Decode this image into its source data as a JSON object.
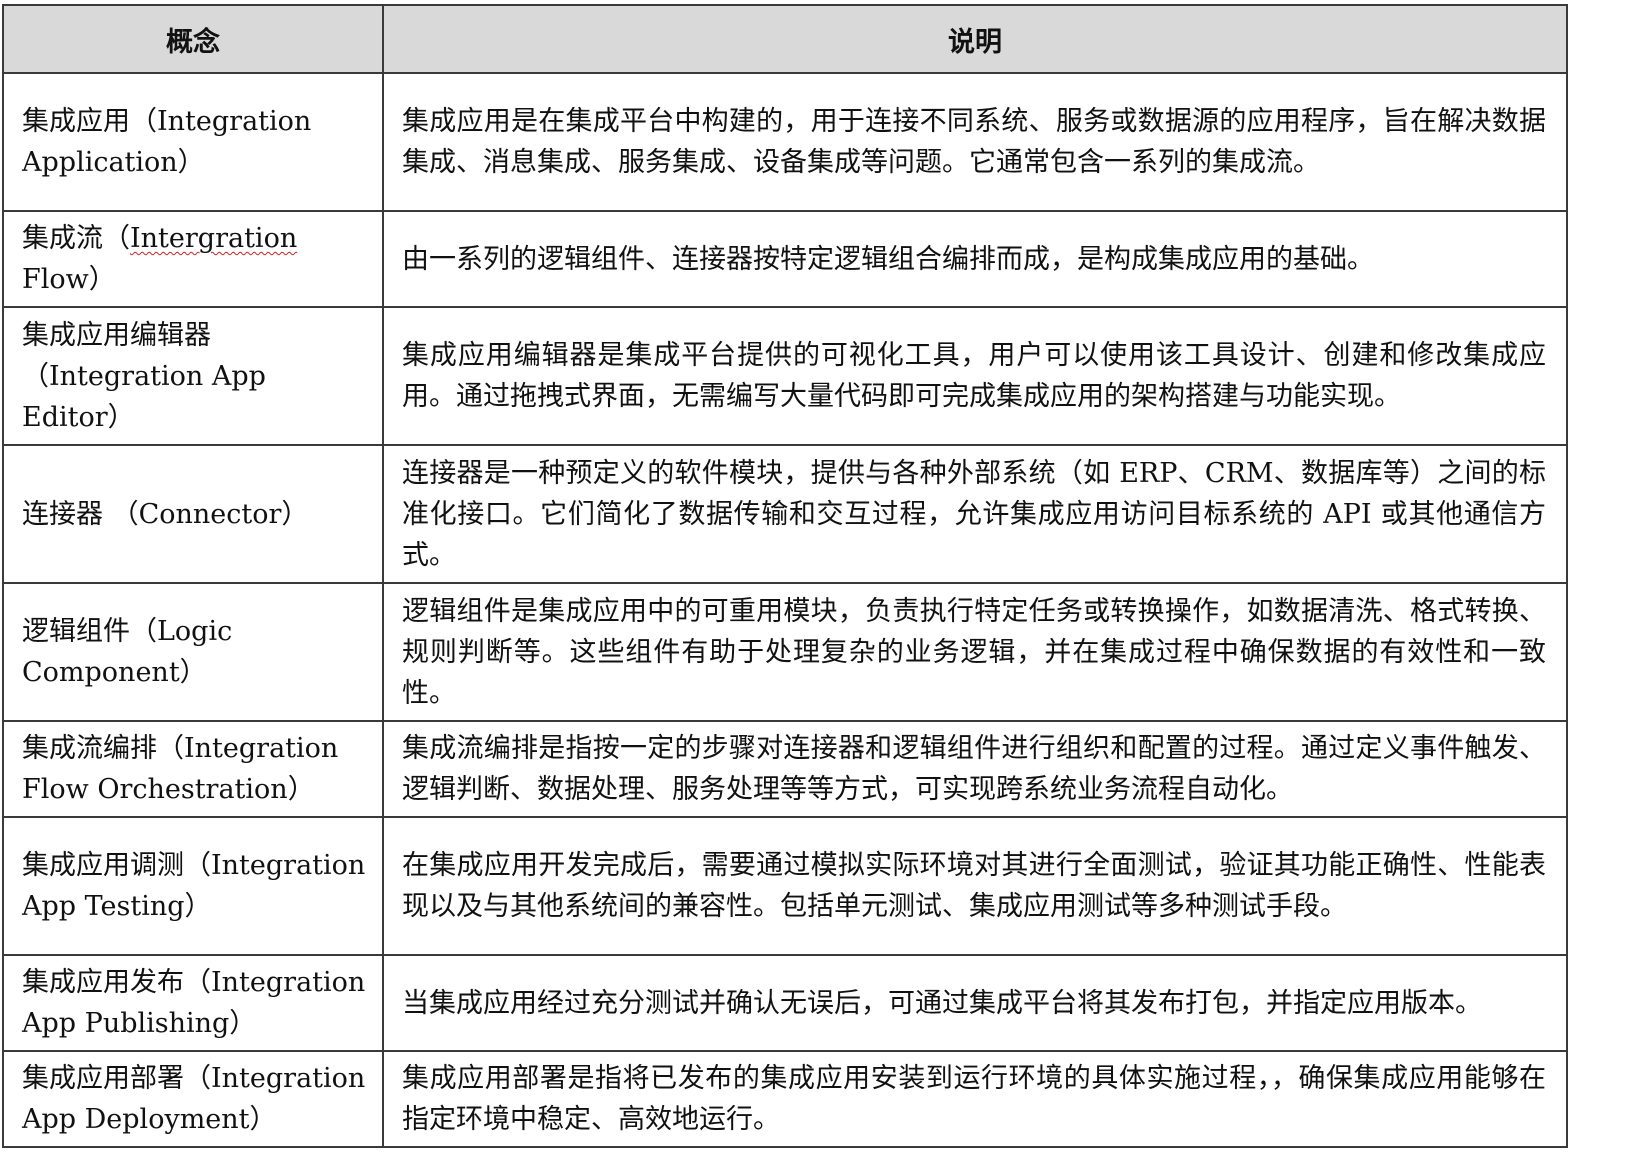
{
  "table": {
    "headers": {
      "concept": "概念",
      "description": "说明"
    },
    "rows": [
      {
        "term": "集成应用（Integration Application）",
        "description": "集成应用是在集成平台中构建的，用于连接不同系统、服务或数据源的应用程序，旨在解决数据集成、消息集成、服务集成、设备集成等问题。它通常包含一系列的集成流。"
      },
      {
        "term_prefix": "集成流（",
        "term_flagged": "Intergration",
        "term_suffix": " Flow）",
        "description": "由一系列的逻辑组件、连接器按特定逻辑组合编排而成，是构成集成应用的基础。"
      },
      {
        "term": "集成应用编辑器（Integration App Editor）",
        "description": "集成应用编辑器是集成平台提供的可视化工具，用户可以使用该工具设计、创建和修改集成应用。通过拖拽式界面，无需编写大量代码即可完成集成应用的架构搭建与功能实现。"
      },
      {
        "term": "连接器 （Connector）",
        "description": "连接器是一种预定义的软件模块，提供与各种外部系统（如 ERP、CRM、数据库等）之间的标准化接口。它们简化了数据传输和交互过程，允许集成应用访问目标系统的 API 或其他通信方式。"
      },
      {
        "term": "逻辑组件（Logic Component）",
        "description": "逻辑组件是集成应用中的可重用模块，负责执行特定任务或转换操作，如数据清洗、格式转换、规则判断等。这些组件有助于处理复杂的业务逻辑，并在集成过程中确保数据的有效性和一致性。"
      },
      {
        "term": "集成流编排（Integration Flow Orchestration）",
        "description": "集成流编排是指按一定的步骤对连接器和逻辑组件进行组织和配置的过程。通过定义事件触发、逻辑判断、数据处理、服务处理等等方式，可实现跨系统业务流程自动化。"
      },
      {
        "term": "集成应用调测（Integration App Testing）",
        "description": "在集成应用开发完成后，需要通过模拟实际环境对其进行全面测试，验证其功能正确性、性能表现以及与其他系统间的兼容性。包括单元测试、集成应用测试等多种测试手段。"
      },
      {
        "term": "集成应用发布（Integration App Publishing）",
        "description": "当集成应用经过充分测试并确认无误后，可通过集成平台将其发布打包，并指定应用版本。"
      },
      {
        "term": "集成应用部署（Integration App Deployment）",
        "description": "集成应用部署是指将已发布的集成应用安装到运行环境的具体实施过程，，确保集成应用能够在指定环境中稳定、高效地运行。"
      }
    ],
    "colors": {
      "header_bg": "#d9d9d9",
      "border": "#3a3a3a",
      "spellcheck_underline": "#d22020"
    }
  }
}
